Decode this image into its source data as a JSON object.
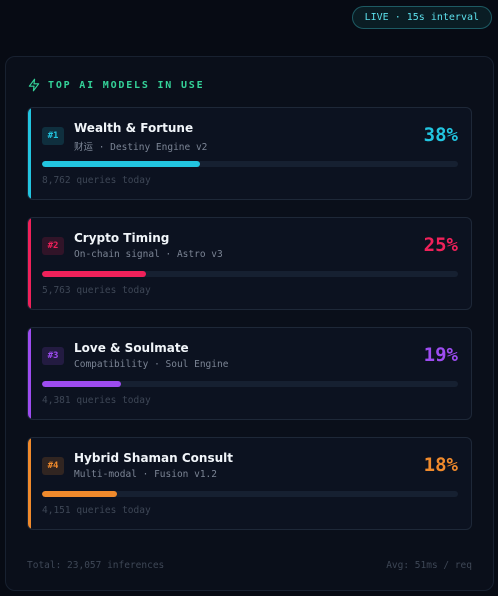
{
  "status": {
    "live_label": "LIVE · 15s interval"
  },
  "panel": {
    "title": "TOP AI MODELS IN USE",
    "icon": "bolt-icon",
    "models": [
      {
        "rank": "#1",
        "name": "Wealth & Fortune",
        "subtitle": "财运 · Destiny Engine v2",
        "percent": "38%",
        "share": 38,
        "queries": "8,762 queries today",
        "color": "#22c5e0"
      },
      {
        "rank": "#2",
        "name": "Crypto Timing",
        "subtitle": "On-chain signal · Astro v3",
        "percent": "25%",
        "share": 25,
        "queries": "5,763 queries today",
        "color": "#f0215a"
      },
      {
        "rank": "#3",
        "name": "Love & Soulmate",
        "subtitle": "Compatibility · Soul Engine",
        "percent": "19%",
        "share": 19,
        "queries": "4,381 queries today",
        "color": "#9d4cf0"
      },
      {
        "rank": "#4",
        "name": "Hybrid Shaman Consult",
        "subtitle": "Multi-modal · Fusion v1.2",
        "percent": "18%",
        "share": 18,
        "queries": "4,151 queries today",
        "color": "#f08a2c"
      }
    ],
    "footer": {
      "total": "Total: 23,057 inferences",
      "avg": "Avg: 51ms / req"
    }
  }
}
